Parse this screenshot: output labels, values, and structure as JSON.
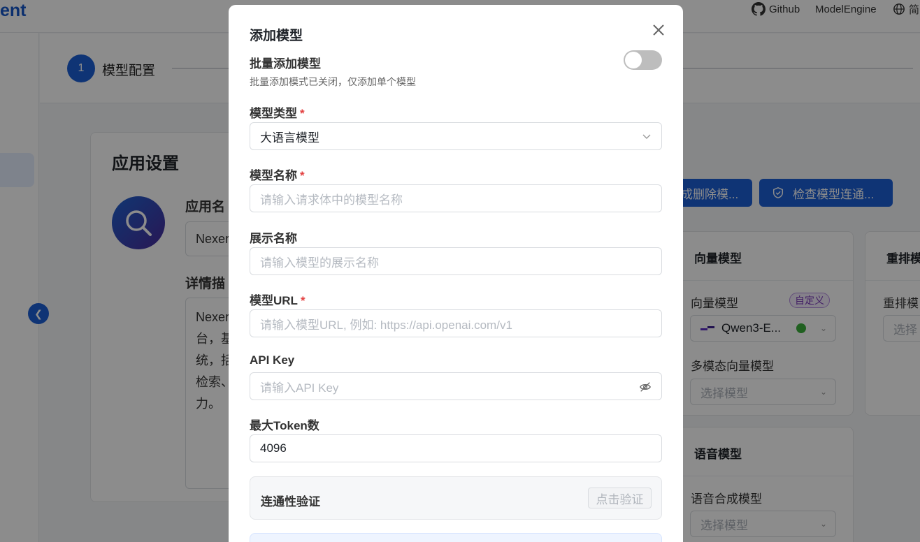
{
  "header": {
    "brand_fragment": "ent",
    "github_label": "Github",
    "modelengine_label": "ModelEngine",
    "lang_label": "简"
  },
  "steps": {
    "current_number": "1",
    "current_label": "模型配置"
  },
  "app_settings": {
    "title": "应用设置",
    "name_label": "应用名",
    "name_value": "Nexer",
    "desc_label": "详情描",
    "desc_lines": [
      "Nexer",
      "台，基",
      "统，括",
      "检索、",
      "力。"
    ]
  },
  "toolbar": {
    "delete_models_label": "成删除模...",
    "check_connect_label": "检查模型连通..."
  },
  "vector_panel": {
    "title": "向量模型",
    "vector_label": "向量模型",
    "custom_tag": "自定义",
    "vector_selected": "Qwen3-E...",
    "multimodal_label": "多模态向量模型",
    "multimodal_placeholder": "选择模型"
  },
  "rerank_panel": {
    "title": "重排模",
    "label": "重排模",
    "placeholder": "选择"
  },
  "speech_panel": {
    "title": "语音模型",
    "tts_label": "语音合成模型",
    "tts_placeholder": "选择模型"
  },
  "modal": {
    "title": "添加模型",
    "batch_label": "批量添加模型",
    "batch_help": "批量添加模式已关闭，仅添加单个模型",
    "batch_enabled": false,
    "type_label": "模型类型",
    "type_value": "大语言模型",
    "name_label": "模型名称",
    "name_placeholder": "请输入请求体中的模型名称",
    "display_label": "展示名称",
    "display_placeholder": "请输入模型的展示名称",
    "url_label": "模型URL",
    "url_placeholder": "请输入模型URL, 例如: https://api.openai.com/v1",
    "apikey_label": "API Key",
    "apikey_placeholder": "请输入API Key",
    "maxtoken_label": "最大Token数",
    "maxtoken_value": "4096",
    "verify_label": "连通性验证",
    "verify_button": "点击验证",
    "required_mark": "*"
  },
  "colors": {
    "primary": "#1d5fd6",
    "required": "#e34040",
    "status_ok": "#3bb03b"
  }
}
